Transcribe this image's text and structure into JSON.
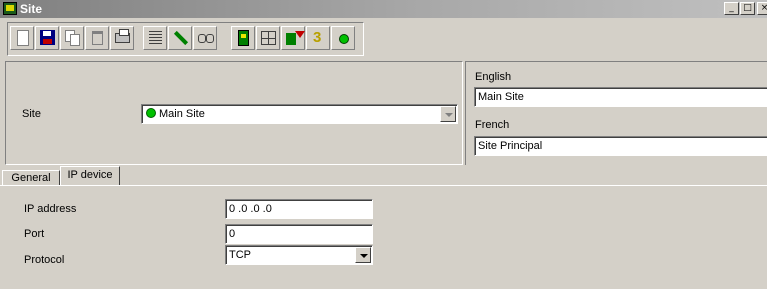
{
  "window": {
    "title": "Site",
    "controls": [
      "minimize",
      "maximize",
      "close"
    ]
  },
  "toolbar": {
    "buttons": [
      {
        "name": "new",
        "icon": "new-document-icon"
      },
      {
        "name": "save",
        "icon": "floppy-disk-icon"
      },
      {
        "name": "copy",
        "icon": "copy-icon"
      },
      {
        "name": "delete",
        "icon": "trash-icon"
      },
      {
        "name": "print",
        "icon": "printer-icon"
      },
      {
        "name": "list",
        "icon": "list-icon"
      },
      {
        "name": "edit",
        "icon": "pencil-icon"
      },
      {
        "name": "find",
        "icon": "binoculars-icon"
      },
      {
        "name": "door",
        "icon": "door-icon"
      },
      {
        "name": "grid",
        "icon": "grid-icon"
      },
      {
        "name": "import",
        "icon": "import-icon"
      },
      {
        "name": "number",
        "icon": "number-three-icon"
      },
      {
        "name": "status",
        "icon": "green-dot-icon"
      }
    ]
  },
  "site": {
    "label": "Site",
    "value": "Main Site",
    "status_color": "#00c000"
  },
  "languages": {
    "english_label": "English",
    "english_value": "Main Site",
    "french_label": "French",
    "french_value": "Site Principal"
  },
  "tabs": [
    {
      "label": "General",
      "active": false
    },
    {
      "label": "IP device",
      "active": true
    }
  ],
  "ip_device": {
    "ip_label": "IP address",
    "ip_value": "0 .0 .0 .0",
    "port_label": "Port",
    "port_value": "0",
    "protocol_label": "Protocol",
    "protocol_value": "TCP"
  }
}
